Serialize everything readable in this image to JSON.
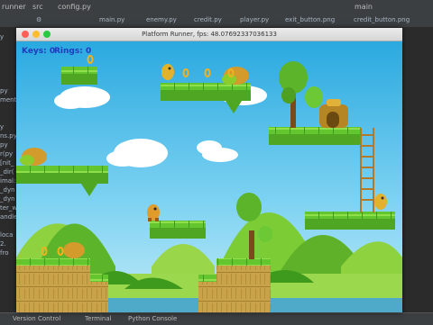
{
  "ide": {
    "project_name": "runner",
    "breadcrumbs": [
      "src",
      "config.py"
    ],
    "branch": "main",
    "tabs": [
      "main.py",
      "enemy.py",
      "credit.py",
      "player.py",
      "exit_button.png",
      "credit_button.png"
    ],
    "left_snippets": [
      "y",
      "py",
      "ment.",
      "",
      "y",
      "ns.py",
      "py",
      "r(py",
      "[nit_",
      "_dir(",
      "imal:",
      "_dyn",
      "_dyn",
      "ter_wa",
      "andle_"
    ],
    "console_snippets": [
      "loca",
      "2.",
      "fro"
    ],
    "status_items": [
      "Version Control",
      "Terminal",
      "Python Console"
    ]
  },
  "window": {
    "title": "Platform Runner, fps: 48.07692337036133"
  },
  "game": {
    "hud": {
      "keys_label": "Keys: 0",
      "rings_label": "Rings: 0"
    },
    "colors": {
      "sky": "#2fb4e6",
      "grass": "#5fc32c",
      "dirt": "#c8a046",
      "hud_text": "#1e3cbd"
    }
  }
}
